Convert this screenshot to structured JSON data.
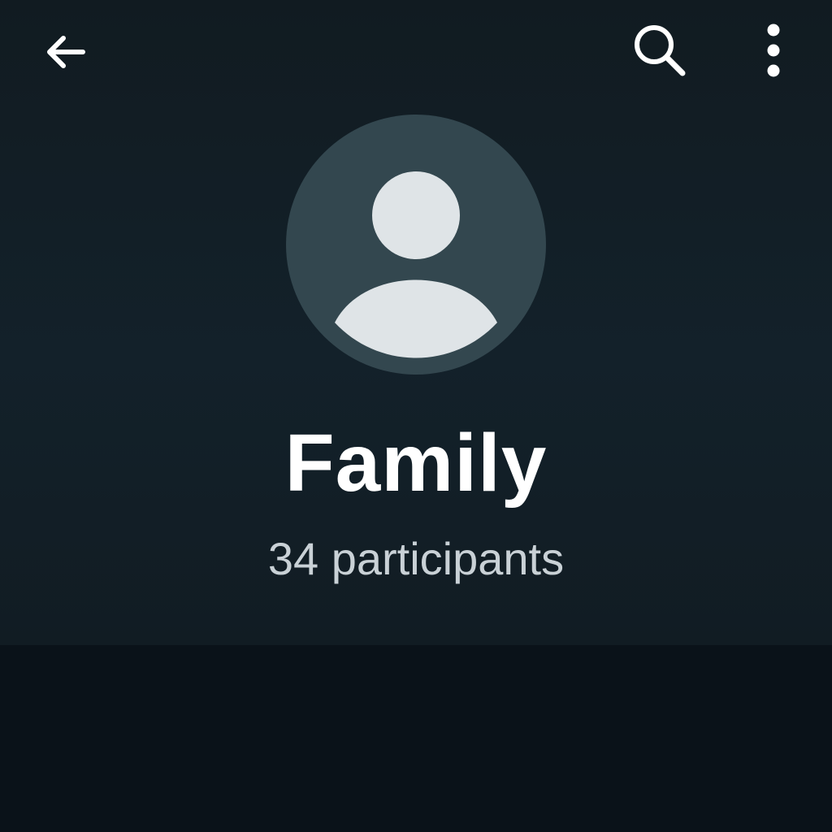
{
  "topbar": {
    "back_icon": "arrow-left-icon",
    "search_icon": "search-icon",
    "menu_icon": "more-vertical-icon"
  },
  "group": {
    "avatar_icon": "default-group-avatar-icon",
    "name": "Family",
    "participants": "34 participants"
  },
  "colors": {
    "background": "#111b21",
    "lower_background": "#0a1219",
    "avatar_bg": "#33474f",
    "avatar_fg": "#dfe4e7",
    "name_text": "#ffffff",
    "subtitle_text": "#c9d1d6",
    "icon": "#ffffff"
  }
}
